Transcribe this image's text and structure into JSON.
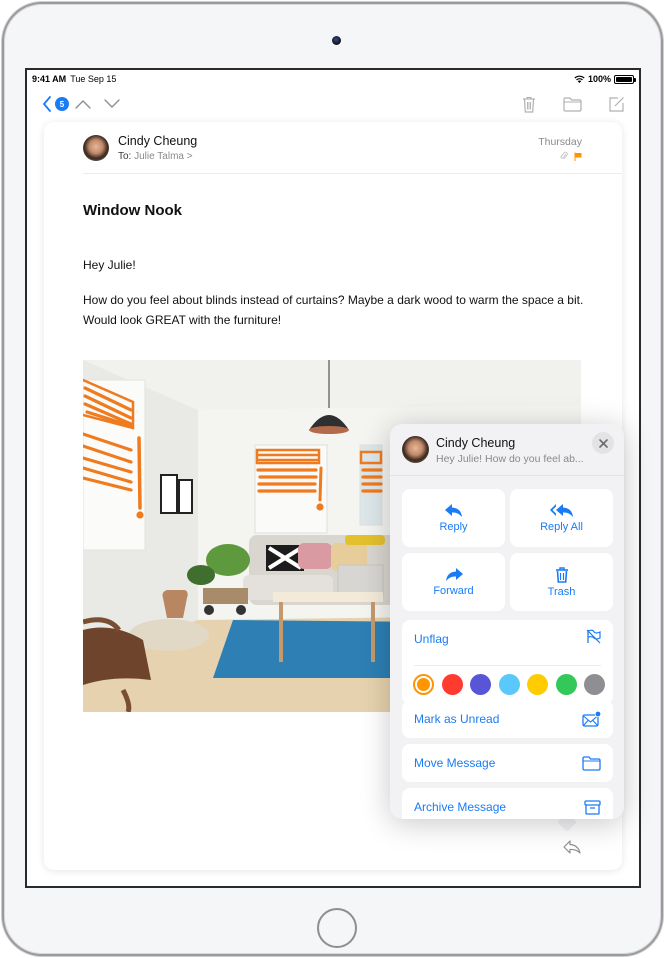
{
  "status_bar": {
    "time": "9:41 AM",
    "date": "Tue Sep 15",
    "battery": "100%"
  },
  "toolbar": {
    "back_count": "5",
    "icons": [
      "chevron-left-icon",
      "chevron-up-icon",
      "chevron-down-icon",
      "trash-icon",
      "folder-icon",
      "compose-icon"
    ]
  },
  "message": {
    "sender": "Cindy Cheung",
    "to_label": "To:",
    "to_name": "Julie Talma",
    "to_chevron": ">",
    "date": "Thursday",
    "has_attachment": true,
    "flag_color": "#ff9500",
    "subject": "Window Nook",
    "greeting": "Hey Julie!",
    "body": "How do you feel about blinds instead of curtains? Maybe a dark wood to warm the space a bit. Would look GREAT with the furniture!"
  },
  "popover": {
    "sender": "Cindy Cheung",
    "preview": "Hey Julie! How do you feel ab...",
    "actions": [
      {
        "label": "Reply",
        "icon": "reply-icon"
      },
      {
        "label": "Reply All",
        "icon": "reply-all-icon"
      },
      {
        "label": "Forward",
        "icon": "forward-icon"
      },
      {
        "label": "Trash",
        "icon": "trash-icon"
      }
    ],
    "flag_label": "Unflag",
    "flag_colors": [
      {
        "name": "orange",
        "hex": "#ff9500",
        "selected": true
      },
      {
        "name": "red",
        "hex": "#ff3b30",
        "selected": false
      },
      {
        "name": "purple",
        "hex": "#5856d6",
        "selected": false
      },
      {
        "name": "blue",
        "hex": "#5ac8fa",
        "selected": false
      },
      {
        "name": "yellow",
        "hex": "#ffcc00",
        "selected": false
      },
      {
        "name": "green",
        "hex": "#34c759",
        "selected": false
      },
      {
        "name": "gray",
        "hex": "#8e8e93",
        "selected": false
      }
    ],
    "rows": [
      {
        "label": "Mark as Unread",
        "icon": "envelope-unread-icon"
      },
      {
        "label": "Move Message",
        "icon": "folder-icon"
      },
      {
        "label": "Archive Message",
        "icon": "archive-box-icon"
      }
    ]
  },
  "colors": {
    "accent": "#1a7cf5",
    "markup_orange": "#f07a1e"
  }
}
